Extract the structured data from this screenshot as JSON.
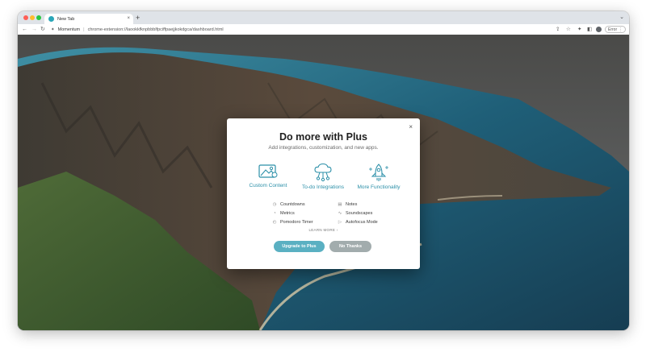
{
  "browser": {
    "tab": {
      "title": "New Tab",
      "close": "×"
    },
    "new_tab": "+",
    "tab_menu": "⌄",
    "nav": {
      "back": "←",
      "forward": "→",
      "reload": "↻"
    },
    "omnibox": {
      "site_label": "Momentum",
      "separator": "|",
      "url": "chrome-extension://laookkfknpbbblfpciffpaejjkokdgca/dashboard.html"
    },
    "toolbar": {
      "share": "⇪",
      "star": "☆",
      "extensions": "✦",
      "sidepanel": "◧",
      "error_label": "Error",
      "menu": "⋮"
    }
  },
  "modal": {
    "close": "×",
    "title": "Do more with Plus",
    "subtitle": "Add integrations, customization, and new apps.",
    "features": [
      {
        "label": "Custom Content",
        "icon": "image-icon"
      },
      {
        "label": "To-do Integrations",
        "icon": "cloud-network-icon"
      },
      {
        "label": "More Functionality",
        "icon": "rocket-icon"
      }
    ],
    "list": [
      {
        "label": "Countdowns",
        "icon": "◷"
      },
      {
        "label": "Notes",
        "icon": "▤"
      },
      {
        "label": "Metrics",
        "icon": "◔"
      },
      {
        "label": "Soundscapes",
        "icon": "∿"
      },
      {
        "label": "Pomodoro Timer",
        "icon": "◴"
      },
      {
        "label": "Autofocus Mode",
        "icon": "▷"
      }
    ],
    "learn_more": "LEARN MORE  ›",
    "upgrade_button": "Upgrade to Plus",
    "no_thanks_button": "No Thanks"
  },
  "colors": {
    "accent": "#5ab0c2",
    "feature_text": "#2b8fa8",
    "secondary_button": "#a2acad"
  }
}
